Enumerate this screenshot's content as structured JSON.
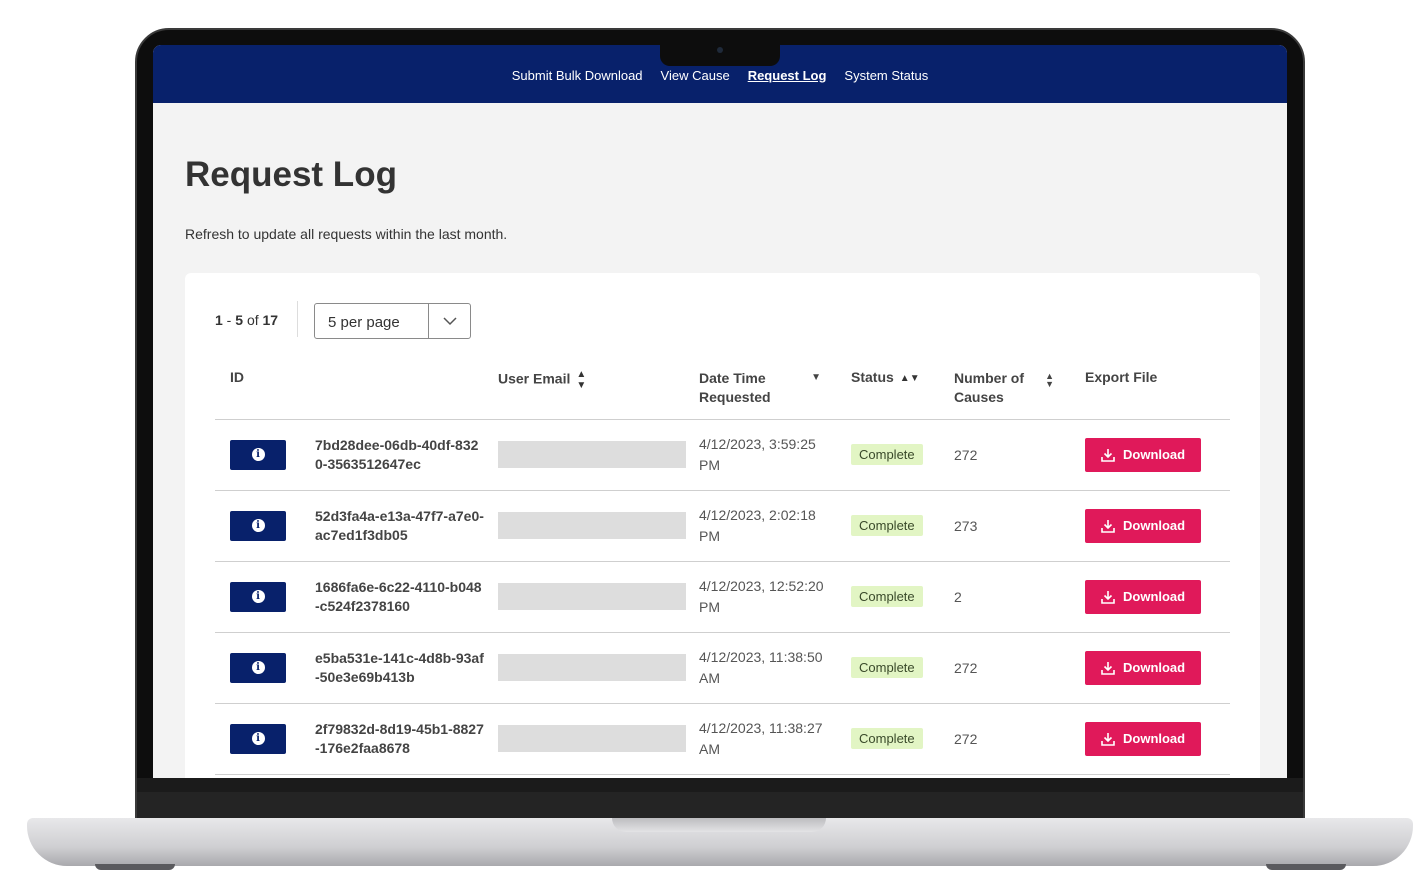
{
  "nav": {
    "items": [
      {
        "label": "Submit Bulk Download",
        "active": false
      },
      {
        "label": "View Cause",
        "active": false
      },
      {
        "label": "Request Log",
        "active": true
      },
      {
        "label": "System Status",
        "active": false
      }
    ]
  },
  "page": {
    "title": "Request Log",
    "subtitle": "Refresh to update all requests within the last month."
  },
  "pagination": {
    "range_start": "1",
    "range_end": "5",
    "of_label": "of",
    "total": "17",
    "per_page_selected": "5 per page"
  },
  "table": {
    "headers": {
      "id": "ID",
      "user_email": "User Email",
      "date_time": "Date Time Requested",
      "status": "Status",
      "causes": "Number of Causes",
      "export": "Export File"
    },
    "rows": [
      {
        "id": "7bd28dee-06db-40df-8320-3563512647ec",
        "date": "4/12/2023, 3:59:25 PM",
        "status": "Complete",
        "causes": "272",
        "action": "Download"
      },
      {
        "id": "52d3fa4a-e13a-47f7-a7e0-ac7ed1f3db05",
        "date": "4/12/2023, 2:02:18 PM",
        "status": "Complete",
        "causes": "273",
        "action": "Download"
      },
      {
        "id": "1686fa6e-6c22-4110-b048-c524f2378160",
        "date": "4/12/2023, 12:52:20 PM",
        "status": "Complete",
        "causes": "2",
        "action": "Download"
      },
      {
        "id": "e5ba531e-141c-4d8b-93af-50e3e69b413b",
        "date": "4/12/2023, 11:38:50 AM",
        "status": "Complete",
        "causes": "272",
        "action": "Download"
      },
      {
        "id": "2f79832d-8d19-45b1-8827-176e2faa8678",
        "date": "4/12/2023, 11:38:27 AM",
        "status": "Complete",
        "causes": "272",
        "action": "Download"
      }
    ]
  },
  "colors": {
    "nav_bg": "#08216b",
    "download_bg": "#e0195a",
    "badge_bg": "#e2f5c4"
  },
  "icons": {
    "info": "info-icon",
    "download": "download-icon",
    "sort": "sort-icon",
    "sort_desc": "sort-desc-icon",
    "chevron": "chevron-down-icon"
  }
}
